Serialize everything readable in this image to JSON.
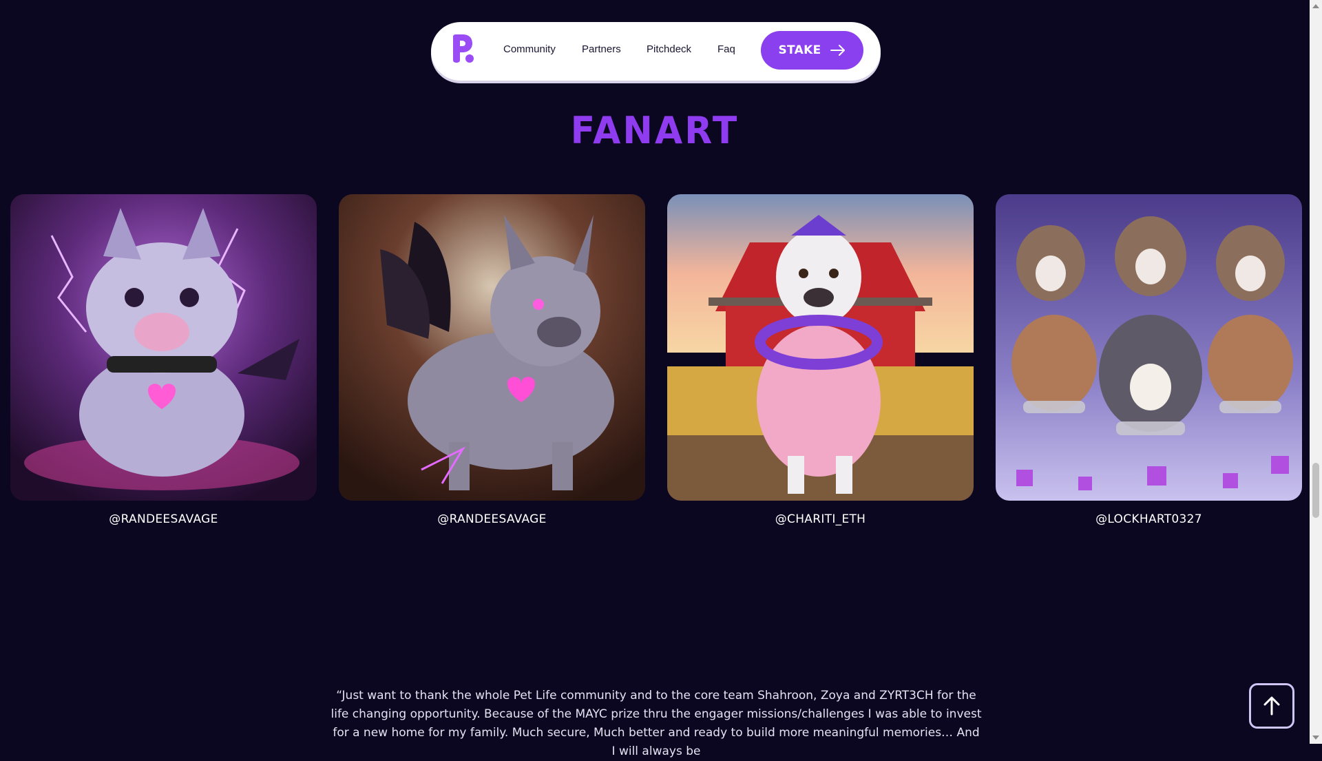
{
  "nav": {
    "links": [
      "Community",
      "Partners",
      "Pitchdeck",
      "Faq"
    ],
    "cta_label": "STAKE",
    "cta_icon": "arrow-right-icon",
    "logo_icon": "pet-life-logo",
    "accent": "#8a40ee"
  },
  "section": {
    "title": "FANART"
  },
  "gallery": {
    "items": [
      {
        "handle": "@RANDEESAVAGE",
        "image": "purple-bulldog-puppy-with-heart-pendant"
      },
      {
        "handle": "@RANDEESAVAGE",
        "image": "winged-bulldog-with-glowing-heart"
      },
      {
        "handle": "@CHARITI_ETH",
        "image": "bulldog-in-pink-robe-at-red-barn"
      },
      {
        "handle": "@LOCKHART0327",
        "image": "group-of-bulldogs-with-chains"
      }
    ]
  },
  "testimonial": {
    "text": "“Just want to thank the whole Pet Life community and to the core team Shahroon, Zoya and ZYRT3CH for the life changing opportunity. Because of the MAYC prize thru the engager missions/challenges I was able to invest for a new home for my family. Much secure, Much better and ready to build more meaningful memories… And I will always be"
  },
  "back_to_top": {
    "icon": "arrow-up-icon"
  },
  "colors": {
    "background": "#0b0721",
    "title": "#8f3bf0",
    "nav_bg": "#ffffff"
  }
}
